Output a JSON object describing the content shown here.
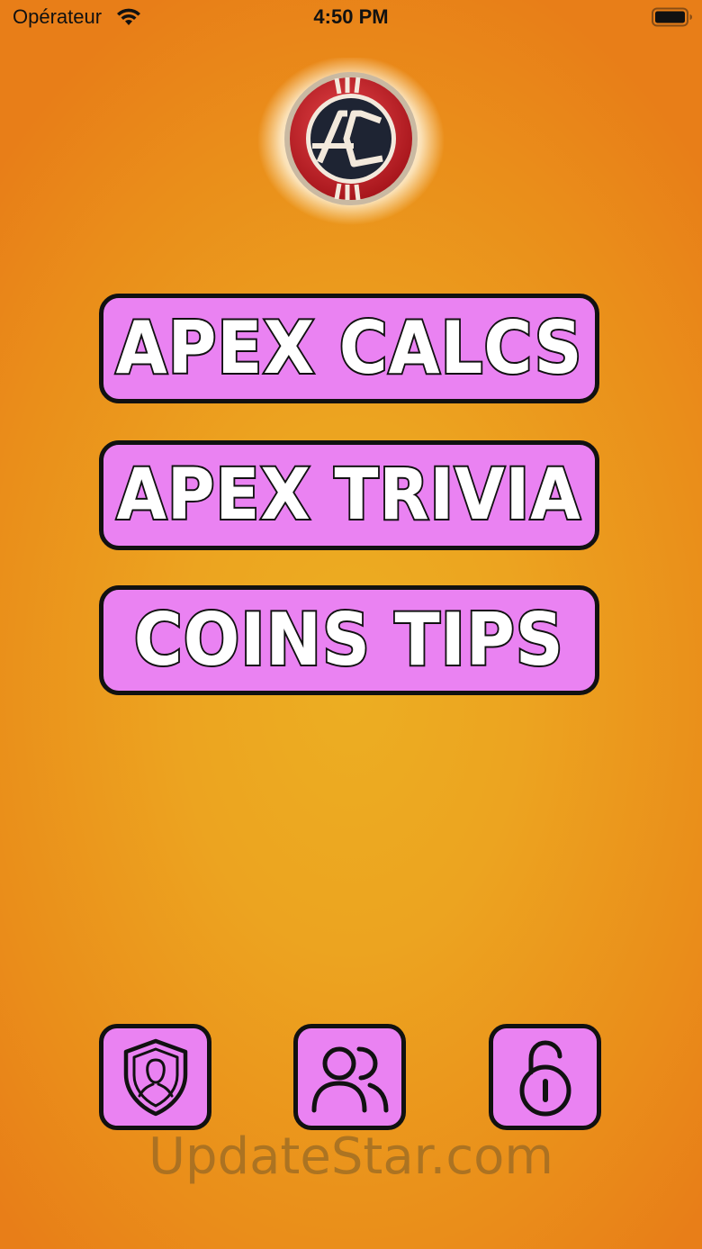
{
  "status_bar": {
    "carrier": "Opérateur",
    "time": "4:50 PM",
    "wifi_icon": "wifi-icon",
    "battery_icon": "battery-icon"
  },
  "logo": {
    "icon": "apex-coins-logo",
    "colors": {
      "ring": "#d8262c",
      "center": "#1e2433",
      "stripe": "#f3e9dc"
    }
  },
  "menu": {
    "items": [
      {
        "label": "APEX CALCS"
      },
      {
        "label": "APEX TRIVIA"
      },
      {
        "label": "COINS TIPS"
      }
    ]
  },
  "bottom_bar": {
    "buttons": [
      {
        "icon": "shield-user-icon"
      },
      {
        "icon": "users-icon"
      },
      {
        "icon": "unlock-icon"
      }
    ]
  },
  "watermark": "UpdateStar.com",
  "colors": {
    "background": "#eca420",
    "button_fill": "#ea82f2",
    "button_border": "#111111",
    "button_text": "#ffffff"
  }
}
